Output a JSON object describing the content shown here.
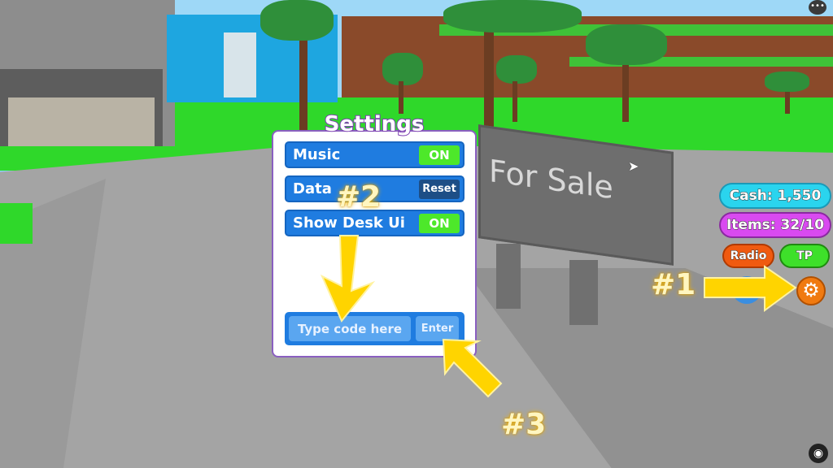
{
  "settings": {
    "title": "Settings",
    "rows": [
      {
        "label": "Music",
        "button": "ON"
      },
      {
        "label": "Data",
        "button": "Reset"
      },
      {
        "label": "Show Desk Ui",
        "button": "ON"
      }
    ],
    "code_placeholder": "Type code here",
    "enter_label": "Enter"
  },
  "hud": {
    "cash": "Cash: 1,550",
    "items": "Items: 32/10",
    "radio": "Radio",
    "tp": "TP"
  },
  "sign_text": "For Sale",
  "annotations": [
    "#1",
    "#2",
    "#3"
  ],
  "colors": {
    "accent_blue": "#1f7ce0",
    "toggle_on": "#4de82a",
    "arrow": "#ffd400",
    "title_outline": "#7b3fb0"
  }
}
